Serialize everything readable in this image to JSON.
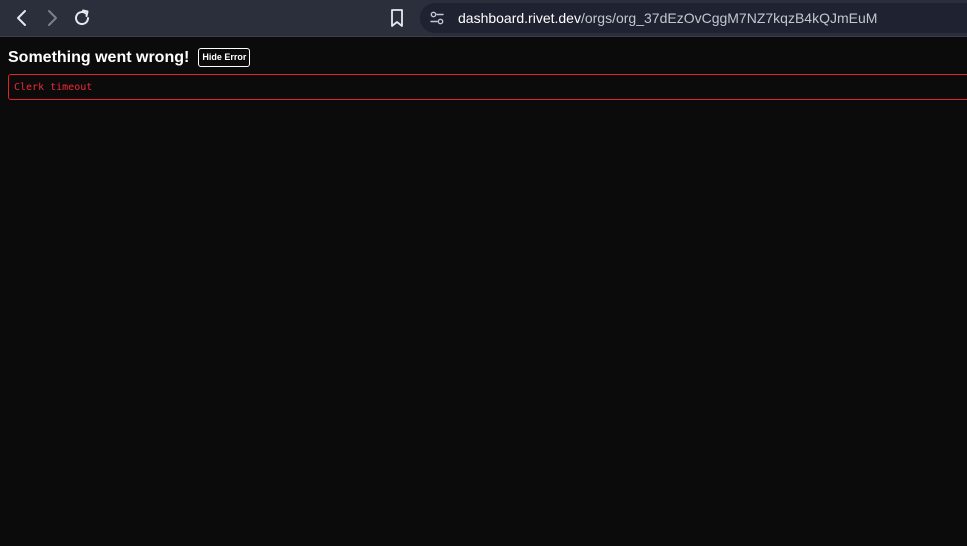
{
  "browser": {
    "icons": {
      "back": "chevron-left-icon",
      "forward": "chevron-right-icon",
      "reload": "reload-icon",
      "bookmark": "bookmark-icon",
      "site_info": "tune-icon"
    },
    "url_host": "dashboard.rivet.dev",
    "url_path": "/orgs/org_37dEzOvCggM7NZ7kqzB4kQJmEuM"
  },
  "error": {
    "title": "Something went wrong!",
    "hide_button_label": "Hide Error",
    "message": "Clerk timeout"
  },
  "colors": {
    "page_background": "#0b0b0b",
    "toolbar_background": "#2b2e3b",
    "error_red": "#f02a35"
  }
}
